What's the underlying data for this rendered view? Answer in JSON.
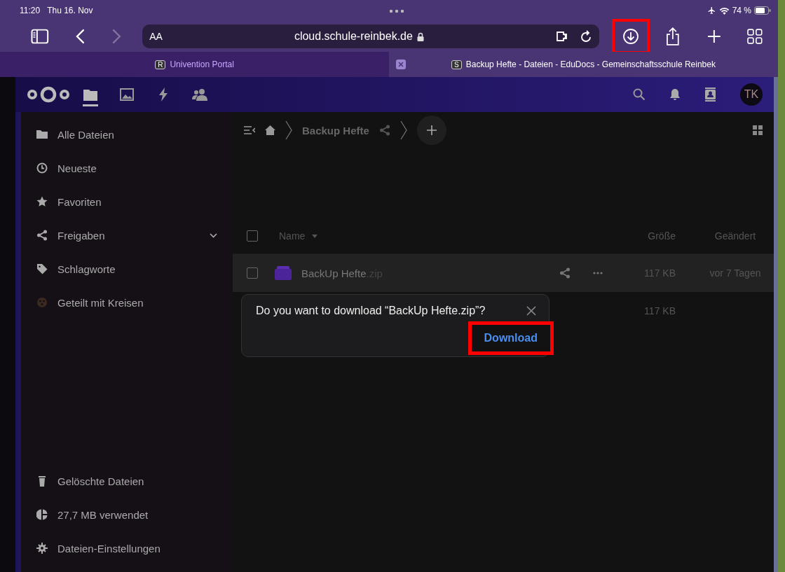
{
  "status_bar": {
    "time": "11:20",
    "date": "Thu 16. Nov",
    "battery": "74 %"
  },
  "browser": {
    "text_size": "AA",
    "url": "cloud.schule-reinbek.de",
    "forward_disabled": true,
    "download_highlighted": true
  },
  "tabs": [
    {
      "favicon": "R",
      "title": "Univention Portal",
      "selected": false
    },
    {
      "favicon": "S",
      "title": "Backup Hefte - Dateien - EduDocs - Gemeinschaftsschule Reinbek",
      "selected": true
    }
  ],
  "app_header": {
    "apps": [
      {
        "selected": true
      },
      {
        "selected": false
      },
      {
        "selected": false
      },
      {
        "selected": false
      }
    ],
    "avatar": "TK"
  },
  "sidebar": {
    "items": [
      {
        "label": "Alle Dateien"
      },
      {
        "label": "Neueste"
      },
      {
        "label": "Favoriten"
      },
      {
        "label": "Freigaben",
        "expandable": true
      },
      {
        "label": "Schlagworte"
      },
      {
        "label": "Geteilt mit Kreisen"
      }
    ],
    "footer": [
      {
        "label": "Gelöschte Dateien"
      },
      {
        "label": "27,7 MB verwendet"
      },
      {
        "label": "Dateien-Einstellungen"
      }
    ]
  },
  "breadcrumb": {
    "folder": "Backup Hefte"
  },
  "table": {
    "columns": [
      "Name",
      "Größe",
      "Geändert"
    ],
    "all_checked": false,
    "rows": [
      {
        "name": "BackUp Hefte",
        "ext": ".zip",
        "size": "117 KB",
        "modified": "vor 7 Tagen",
        "selected": true,
        "checked": false
      },
      {
        "size": "117 KB",
        "selected": false
      }
    ]
  },
  "dialog": {
    "message": "Do you want to download “BackUp Hefte.zip”?",
    "button": "Download",
    "button_highlighted": true
  }
}
